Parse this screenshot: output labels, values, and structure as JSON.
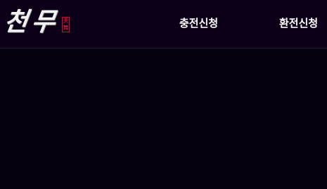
{
  "header": {
    "logo": {
      "text": "천무",
      "seal": "天舞"
    },
    "nav": {
      "charge_label": "충전신청",
      "exchange_label": "환전신청"
    }
  },
  "colors": {
    "background": "#06000f",
    "header_background": "#0c0019",
    "nav_text": "#ffffff",
    "seal_red": "#c8102e"
  }
}
